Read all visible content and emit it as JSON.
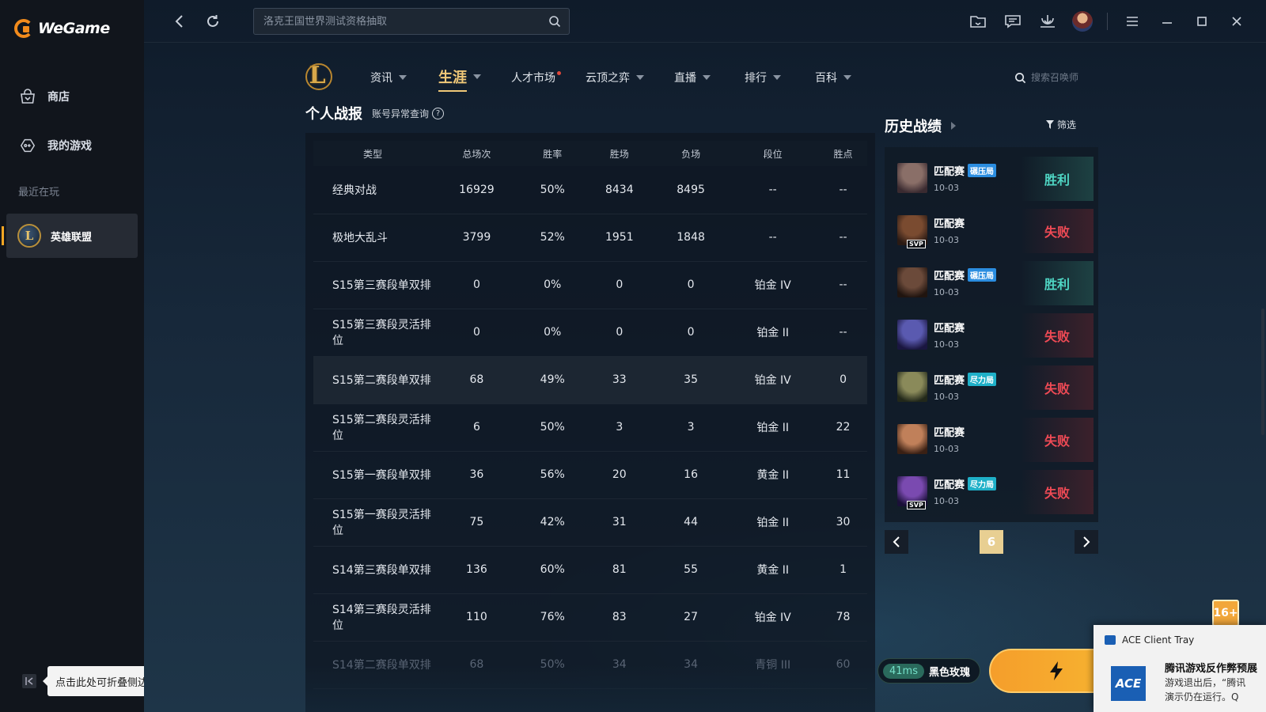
{
  "app": {
    "logo_text": "WeGame"
  },
  "sidebar": {
    "items": [
      {
        "label": "商店",
        "icon": "shop-bag-icon"
      },
      {
        "label": "我的游戏",
        "icon": "gamepad-icon"
      }
    ],
    "recent_label": "最近在玩",
    "recent_game": {
      "label": "英雄联盟",
      "logo_letter": "L"
    },
    "collapse_tip": "点击此处可折叠侧边栏"
  },
  "topbar": {
    "search_placeholder": "洛克王国世界测试资格抽取",
    "icons": [
      "folder-icon",
      "message-icon",
      "download-icon",
      "user-avatar",
      "menu-icon",
      "minimize-icon",
      "maximize-icon",
      "close-icon"
    ]
  },
  "game_nav": {
    "logo_letter": "L",
    "items": [
      {
        "label": "资讯",
        "caret": true
      },
      {
        "label": "生涯",
        "caret": true,
        "active": true
      },
      {
        "label": "人才市场",
        "caret": false,
        "dot": true
      },
      {
        "label": "云顶之弈",
        "caret": true
      },
      {
        "label": "直播",
        "caret": true
      },
      {
        "label": "排行",
        "caret": true
      },
      {
        "label": "百科",
        "caret": true
      }
    ],
    "summoner_search_placeholder": "搜索召唤师"
  },
  "record": {
    "title": "个人战报",
    "account_link": "账号异常查询",
    "help_glyph": "?",
    "columns": [
      "类型",
      "总场次",
      "胜率",
      "胜场",
      "负场",
      "段位",
      "胜点"
    ],
    "rows": [
      [
        "经典对战",
        "16929",
        "50%",
        "8434",
        "8495",
        "--",
        "--"
      ],
      [
        "极地大乱斗",
        "3799",
        "52%",
        "1951",
        "1848",
        "--",
        "--"
      ],
      [
        "S15第三赛段单双排",
        "0",
        "0%",
        "0",
        "0",
        "铂金 IV",
        "--"
      ],
      [
        "S15第三赛段灵活排位",
        "0",
        "0%",
        "0",
        "0",
        "铂金 II",
        "--"
      ],
      [
        "S15第二赛段单双排",
        "68",
        "49%",
        "33",
        "35",
        "铂金 IV",
        "0"
      ],
      [
        "S15第二赛段灵活排位",
        "6",
        "50%",
        "3",
        "3",
        "铂金 II",
        "22"
      ],
      [
        "S15第一赛段单双排",
        "36",
        "56%",
        "20",
        "16",
        "黄金 II",
        "11"
      ],
      [
        "S15第一赛段灵活排位",
        "75",
        "42%",
        "31",
        "44",
        "铂金 II",
        "30"
      ],
      [
        "S14第三赛段单双排",
        "136",
        "60%",
        "81",
        "55",
        "黄金 II",
        "1"
      ],
      [
        "S14第三赛段灵活排位",
        "110",
        "76%",
        "83",
        "27",
        "铂金 IV",
        "78"
      ],
      [
        "S14第二赛段单双排",
        "68",
        "50%",
        "34",
        "34",
        "青铜 III",
        "60"
      ]
    ],
    "highlight_row": 4
  },
  "history": {
    "title": "历史战绩",
    "filter_label": "筛选",
    "matches": [
      {
        "mode": "匹配赛",
        "badge": "碾压局",
        "badge_type": "crush",
        "date": "10-03",
        "result": "胜利",
        "win": true,
        "svp": false,
        "colors": [
          "#8a6f68",
          "#3a2a30"
        ]
      },
      {
        "mode": "匹配赛",
        "badge": "",
        "badge_type": "",
        "date": "10-03",
        "result": "失败",
        "win": false,
        "svp": true,
        "svp_label": "SVP",
        "colors": [
          "#7a4b30",
          "#2a1a14"
        ]
      },
      {
        "mode": "匹配赛",
        "badge": "碾压局",
        "badge_type": "crush",
        "date": "10-03",
        "result": "胜利",
        "win": true,
        "svp": false,
        "colors": [
          "#6b4a3a",
          "#20140f"
        ]
      },
      {
        "mode": "匹配赛",
        "badge": "",
        "badge_type": "",
        "date": "10-03",
        "result": "失败",
        "win": false,
        "svp": false,
        "colors": [
          "#5a5ab0",
          "#1a1640"
        ]
      },
      {
        "mode": "匹配赛",
        "badge": "尽力局",
        "badge_type": "tryhard",
        "date": "10-03",
        "result": "失败",
        "win": false,
        "svp": false,
        "colors": [
          "#8a8a5a",
          "#22281a"
        ]
      },
      {
        "mode": "匹配赛",
        "badge": "",
        "badge_type": "",
        "date": "10-03",
        "result": "失败",
        "win": false,
        "svp": false,
        "colors": [
          "#c0805a",
          "#3a2014"
        ]
      },
      {
        "mode": "匹配赛",
        "badge": "尽力局",
        "badge_type": "tryhard",
        "date": "10-03",
        "result": "失败",
        "win": false,
        "svp": true,
        "svp_label": "SVP",
        "colors": [
          "#7a4ab0",
          "#1a1038"
        ]
      }
    ],
    "page": "6"
  },
  "bottom": {
    "ping": "41ms",
    "server": "黑色玫瑰",
    "age_rating": "16+"
  },
  "ace_toast": {
    "app_name": "ACE Client Tray",
    "logo_text": "ACE",
    "title": "腾讯游戏反作弊预展",
    "body_line1": "游戏退出后，“腾讯",
    "body_line2": "演示仍在运行。Q"
  }
}
